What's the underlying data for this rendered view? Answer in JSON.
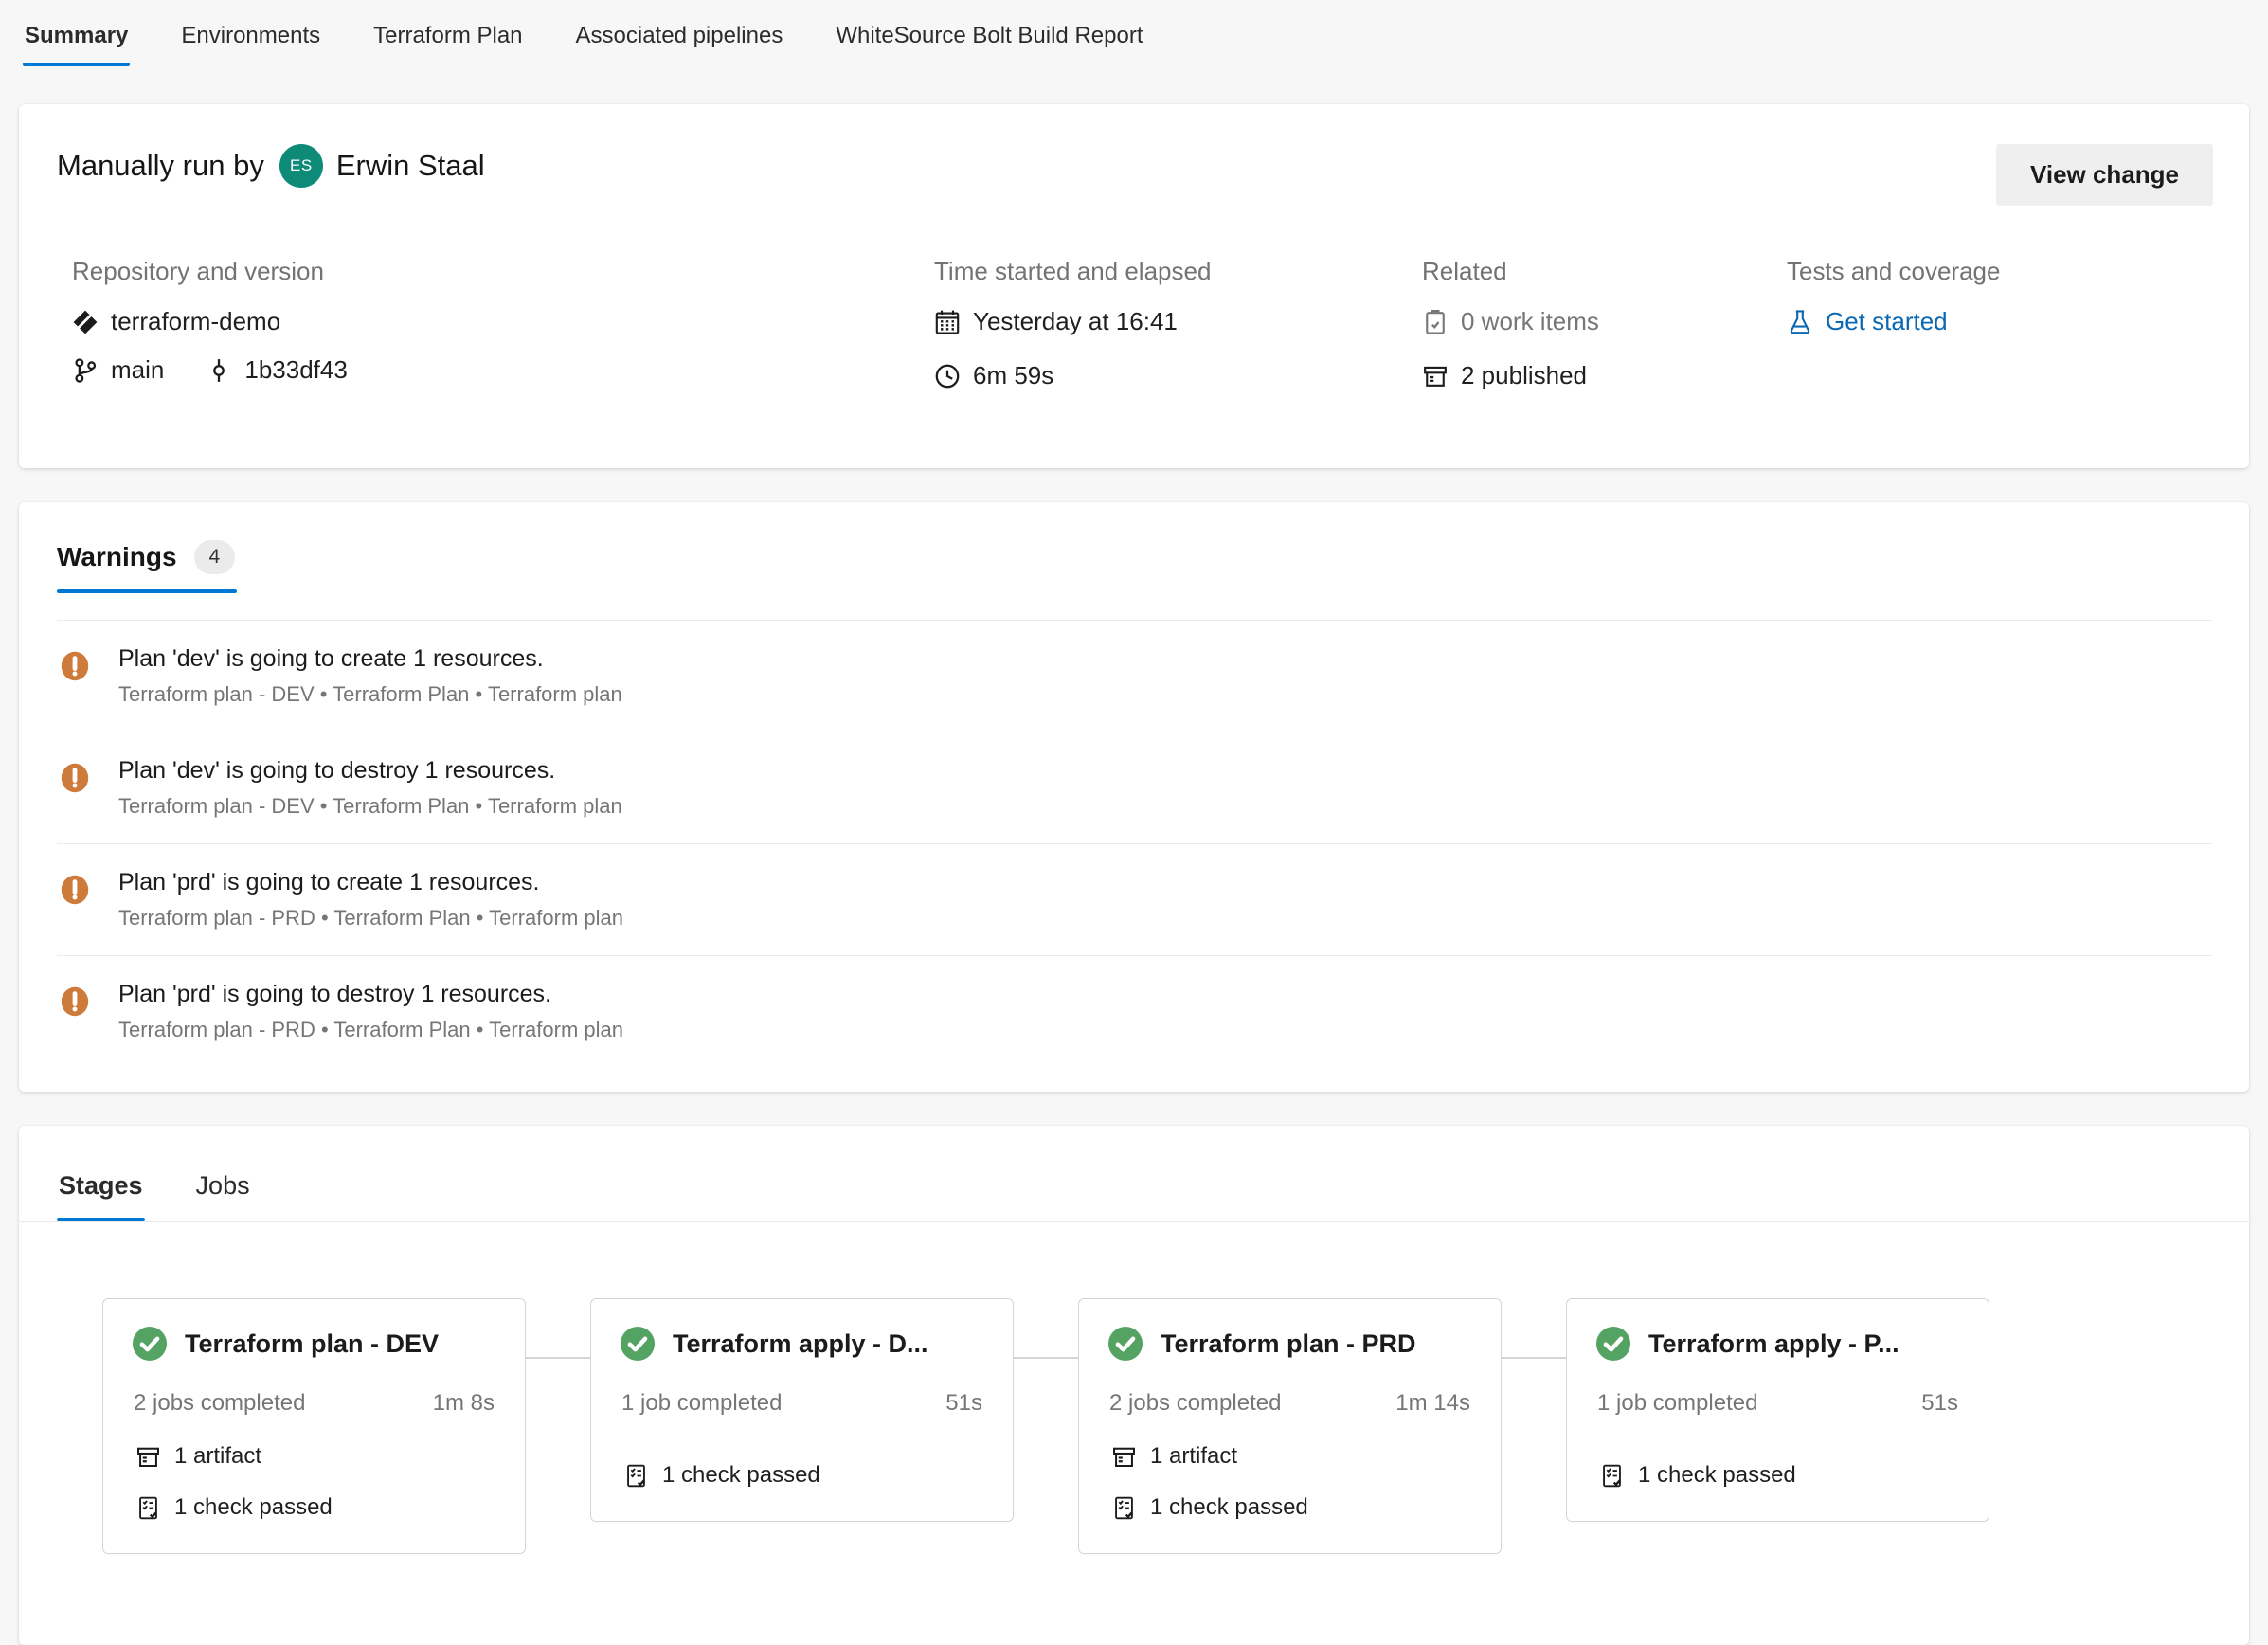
{
  "tabs": [
    {
      "label": "Summary",
      "active": true
    },
    {
      "label": "Environments",
      "active": false
    },
    {
      "label": "Terraform Plan",
      "active": false
    },
    {
      "label": "Associated pipelines",
      "active": false
    },
    {
      "label": "WhiteSource Bolt Build Report",
      "active": false
    }
  ],
  "summary": {
    "run_by_prefix": "Manually run by",
    "avatar_initials": "ES",
    "run_by_name": "Erwin Staal",
    "view_change_label": "View change",
    "repository": {
      "heading": "Repository and version",
      "repo_name": "terraform-demo",
      "branch": "main",
      "commit": "1b33df43"
    },
    "time": {
      "heading": "Time started and elapsed",
      "started": "Yesterday at 16:41",
      "elapsed": "6m 59s"
    },
    "related": {
      "heading": "Related",
      "work_items": "0 work items",
      "published": "2 published"
    },
    "tests": {
      "heading": "Tests and coverage",
      "link": "Get started"
    }
  },
  "warnings": {
    "tab_label": "Warnings",
    "count": "4",
    "items": [
      {
        "title": "Plan 'dev' is going to create 1 resources.",
        "subtitle": "Terraform plan - DEV • Terraform Plan • Terraform plan"
      },
      {
        "title": "Plan 'dev' is going to destroy 1 resources.",
        "subtitle": "Terraform plan - DEV • Terraform Plan • Terraform plan"
      },
      {
        "title": "Plan 'prd' is going to create 1 resources.",
        "subtitle": "Terraform plan - PRD • Terraform Plan • Terraform plan"
      },
      {
        "title": "Plan 'prd' is going to destroy 1 resources.",
        "subtitle": "Terraform plan - PRD • Terraform Plan • Terraform plan"
      }
    ]
  },
  "stages": {
    "tabs": [
      {
        "label": "Stages",
        "active": true
      },
      {
        "label": "Jobs",
        "active": false
      }
    ],
    "cards": [
      {
        "title": "Terraform plan - DEV",
        "jobs": "2 jobs completed",
        "duration": "1m 8s",
        "artifact": "1 artifact",
        "check": "1 check passed"
      },
      {
        "title": "Terraform apply - D...",
        "jobs": "1 job completed",
        "duration": "51s",
        "check": "1 check passed"
      },
      {
        "title": "Terraform plan - PRD",
        "jobs": "2 jobs completed",
        "duration": "1m 14s",
        "artifact": "1 artifact",
        "check": "1 check passed"
      },
      {
        "title": "Terraform apply - P...",
        "jobs": "1 job completed",
        "duration": "51s",
        "check": "1 check passed"
      }
    ]
  },
  "icons": {
    "avatar": "user-initials",
    "repo": "azure-repos-icon",
    "branch": "git-branch-icon",
    "commit": "git-commit-icon",
    "calendar": "calendar-icon",
    "clock": "clock-icon",
    "work_items": "clipboard-check-icon",
    "published": "artifact-box-icon",
    "tests": "beaker-icon",
    "warning": "warning-exclamation-icon",
    "stage_success": "check-circle-icon",
    "check_passed": "checklist-icon"
  },
  "colors": {
    "accent_blue": "#0078d4",
    "link_blue": "#0b69b4",
    "success_green": "#55a362",
    "warning_orange": "#ce7a3b",
    "avatar_teal": "#0e8a79",
    "muted_gray": "#767676",
    "page_bg": "#f7f7f7"
  }
}
